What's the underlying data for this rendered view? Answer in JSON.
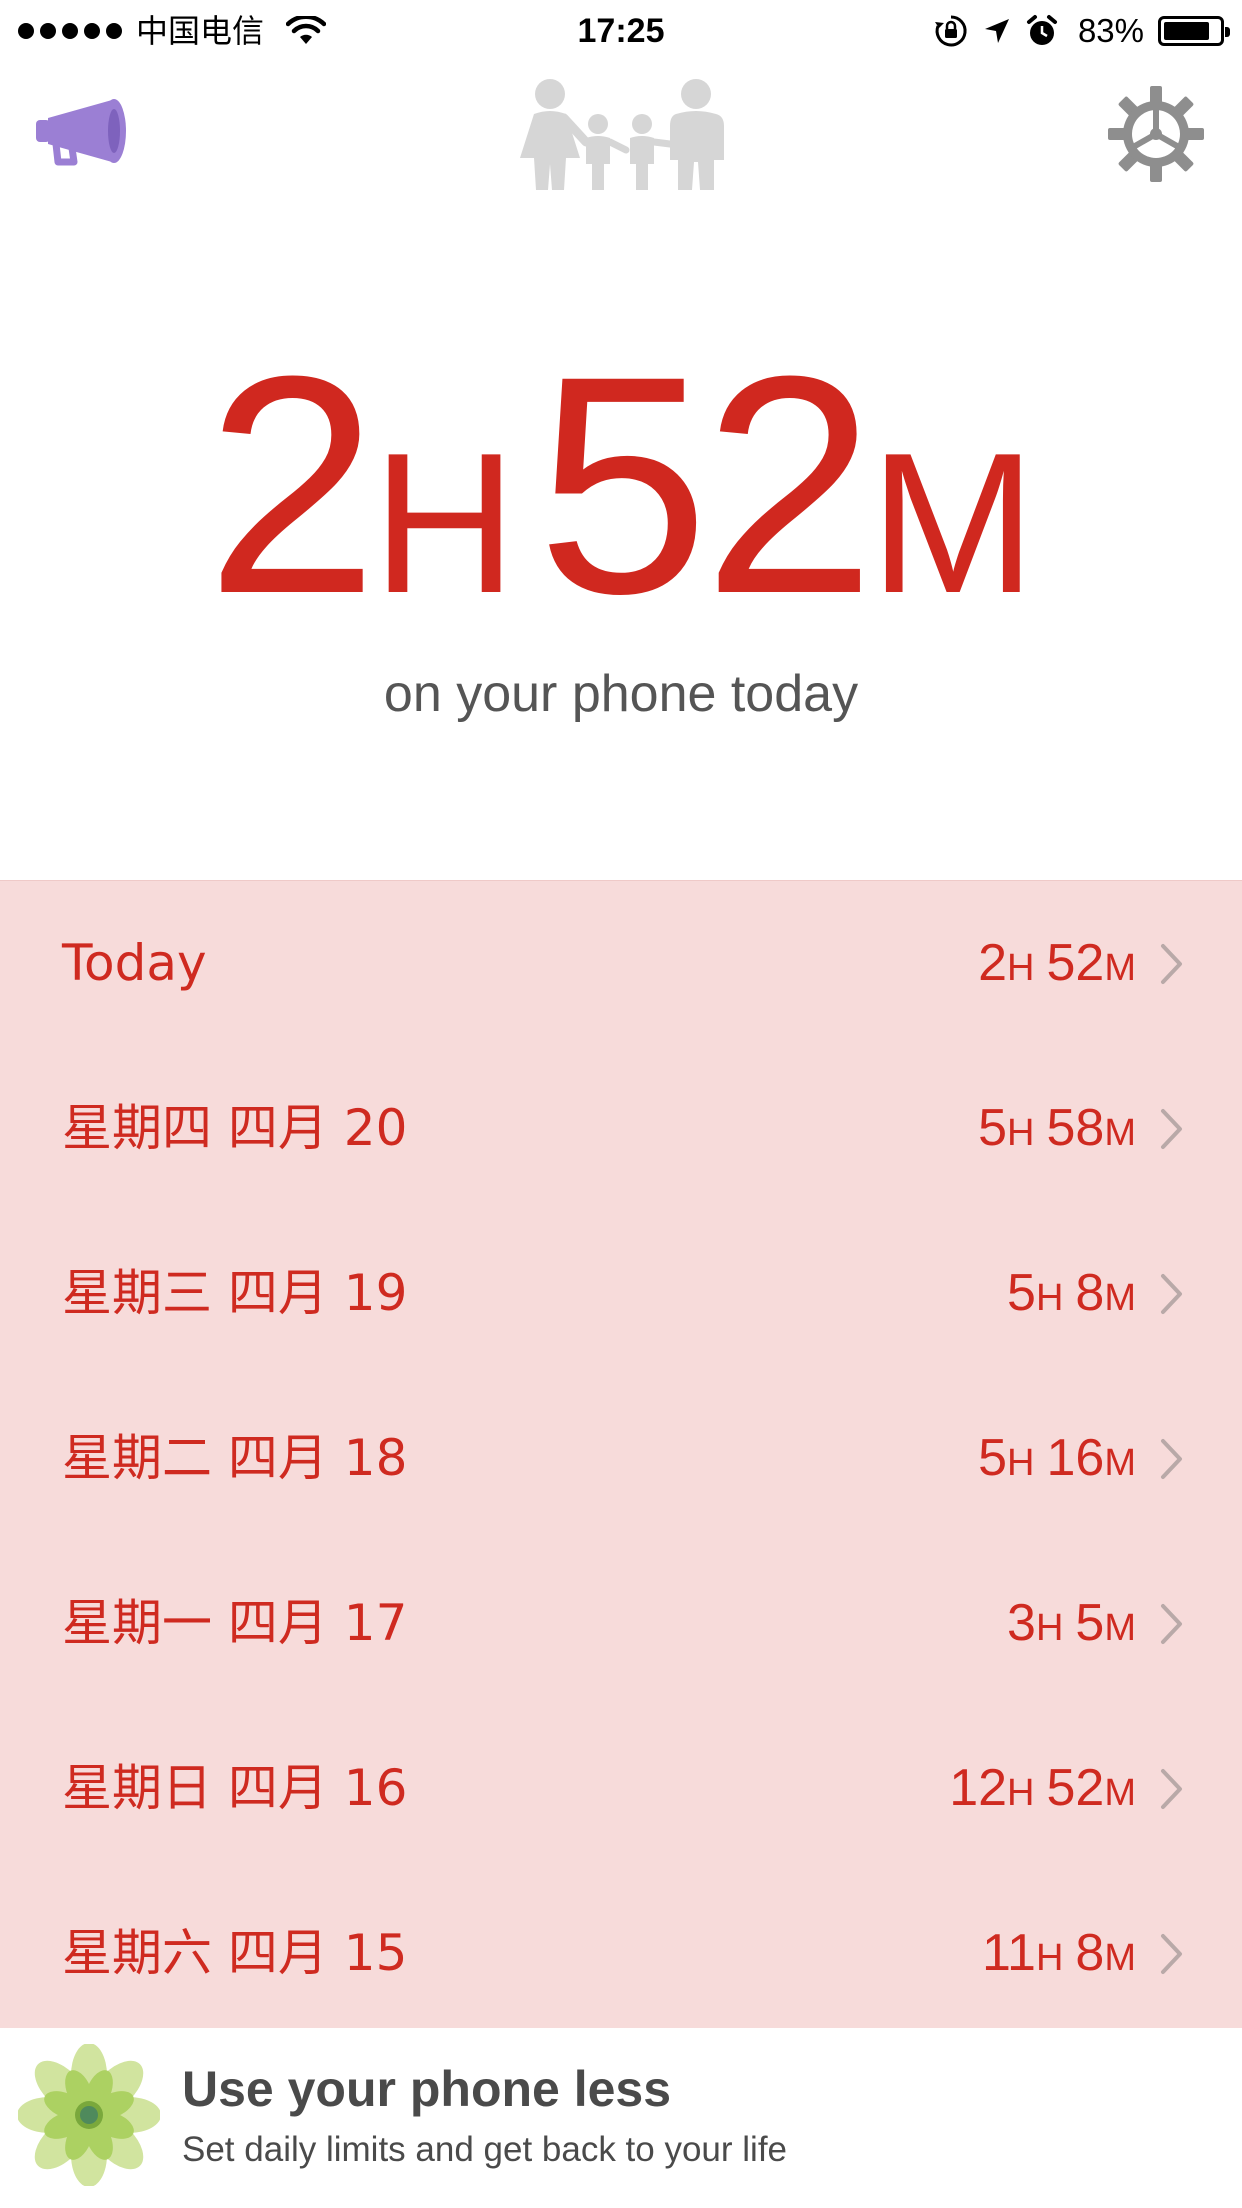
{
  "status_bar": {
    "carrier": "中国电信",
    "time": "17:25",
    "battery_percent": "83%",
    "battery_level": 0.83,
    "icons": [
      "signal-dots",
      "wifi-icon",
      "orientation-lock-icon",
      "location-arrow-icon",
      "alarm-icon",
      "battery-icon"
    ]
  },
  "header": {
    "left_icon": "megaphone-icon",
    "center_icon": "family-icon",
    "right_icon": "gear-icon",
    "colors": {
      "megaphone": "#9b7fd4",
      "family": "#d4d4d4",
      "gear": "#8e8e8e"
    }
  },
  "total": {
    "hours": "2",
    "hours_unit": "H",
    "minutes": "52",
    "minutes_unit": "M",
    "caption": "on your phone today"
  },
  "history": [
    {
      "label": "Today",
      "hours": "2",
      "minutes": "52"
    },
    {
      "label": "星期四 四月 20",
      "hours": "5",
      "minutes": "58"
    },
    {
      "label": "星期三 四月 19",
      "hours": "5",
      "minutes": "8"
    },
    {
      "label": "星期二 四月 18",
      "hours": "5",
      "minutes": "16"
    },
    {
      "label": "星期一 四月 17",
      "hours": "3",
      "minutes": "5"
    },
    {
      "label": "星期日 四月 16",
      "hours": "12",
      "minutes": "52"
    },
    {
      "label": "星期六 四月 15",
      "hours": "11",
      "minutes": "8"
    }
  ],
  "units": {
    "hour": "H",
    "minute": "M"
  },
  "promo": {
    "icon": "lotus-icon",
    "title": "Use your phone less",
    "subtitle": "Set daily limits and get back to your life"
  },
  "colors": {
    "accent": "#d0281f",
    "list_background": "#f7dbda",
    "caption_text": "#555555"
  }
}
